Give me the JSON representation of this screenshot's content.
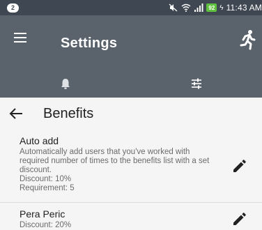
{
  "status_bar": {
    "notification_count": "2",
    "battery_level": "92",
    "time": "11:43 AM"
  },
  "app_bar": {
    "title": "Settings",
    "menu_icon": "hamburger-menu-icon",
    "action_icon": "running-person-icon"
  },
  "tabs": [
    {
      "icon": "bell-icon"
    },
    {
      "icon": "sliders-icon"
    }
  ],
  "section": {
    "title": "Benefits",
    "back_icon": "arrow-left-icon"
  },
  "items": [
    {
      "title": "Auto add",
      "description": "Automatically add users that you've worked with required number of times to the benefits list with a set discount.",
      "discount": "Discount: 10%",
      "requirement": "Requirement: 5",
      "edit_icon": "pencil-icon"
    },
    {
      "title": "Pera Peric",
      "discount": "Discount: 20%",
      "edit_icon": "pencil-icon"
    }
  ],
  "colors": {
    "app_bar": "#5a626c",
    "status_bar": "#3f4752",
    "background": "#f5f5f5",
    "battery": "#5ec03d"
  }
}
